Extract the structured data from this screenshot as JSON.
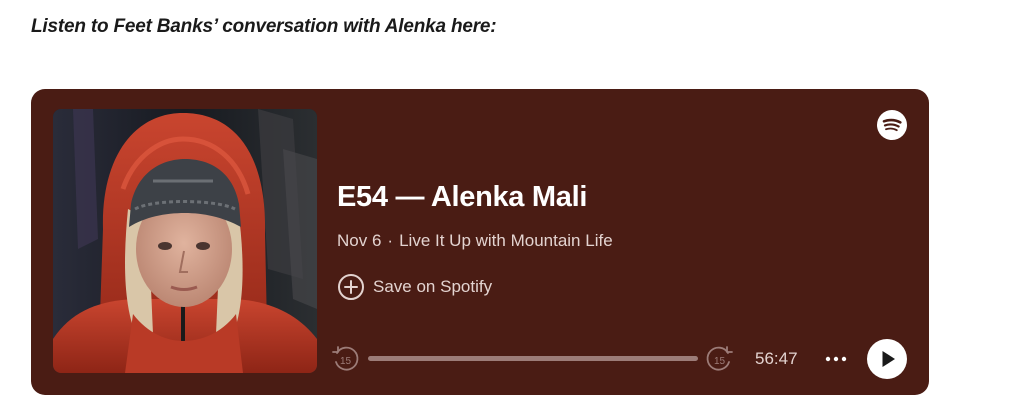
{
  "intro": "Listen to Feet Banks’ conversation with Alenka here:",
  "embed": {
    "background": "#4a1c14",
    "cover_alt": "Podcast cover: person in a red hooded down jacket and dark knit headband",
    "title": "E54 — Alenka Mali",
    "date": "Nov 6",
    "separator": "·",
    "show": "Live It Up with Mountain Life",
    "save_label": "Save on Spotify",
    "duration": "56:47",
    "progress": 0,
    "skip_back_seconds": "15",
    "skip_forward_seconds": "15",
    "icons": {
      "brand": "spotify-icon",
      "save": "plus-circle-icon",
      "back": "skip-back-15-icon",
      "forward": "skip-forward-15-icon",
      "more": "more-options-icon",
      "play": "play-icon"
    }
  }
}
